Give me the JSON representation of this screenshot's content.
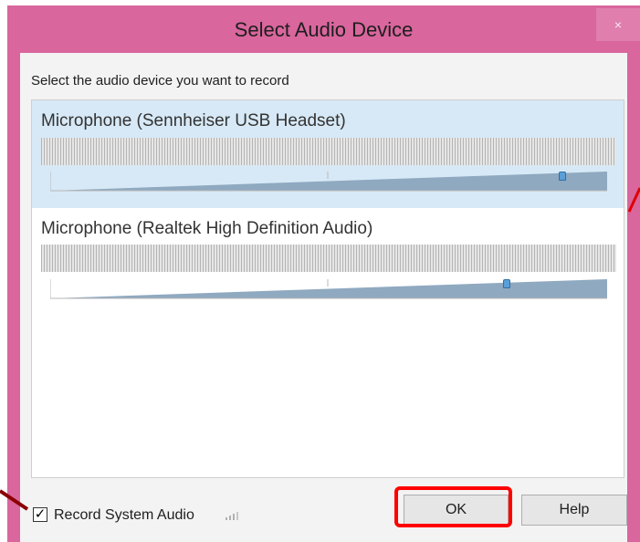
{
  "window": {
    "title": "Select Audio Device",
    "close_glyph": "×",
    "frame_color": "#d9669d"
  },
  "instruction": "Select the audio device you want to record",
  "devices": [
    {
      "name": "Microphone (Sennheiser USB Headset)",
      "selected": true,
      "volume_fraction": 0.92
    },
    {
      "name": "Microphone (Realtek High Definition Audio)",
      "selected": false,
      "volume_fraction": 0.82
    }
  ],
  "footer": {
    "checkbox_checked": true,
    "checkbox_glyph": "✓",
    "checkbox_label": "Record System Audio",
    "signal_icon": "signal-strength-icon"
  },
  "buttons": {
    "ok_label": "OK",
    "help_label": "Help"
  },
  "annotation": {
    "highlight_color": "#ff0000",
    "highlighted_control": "ok-button"
  }
}
